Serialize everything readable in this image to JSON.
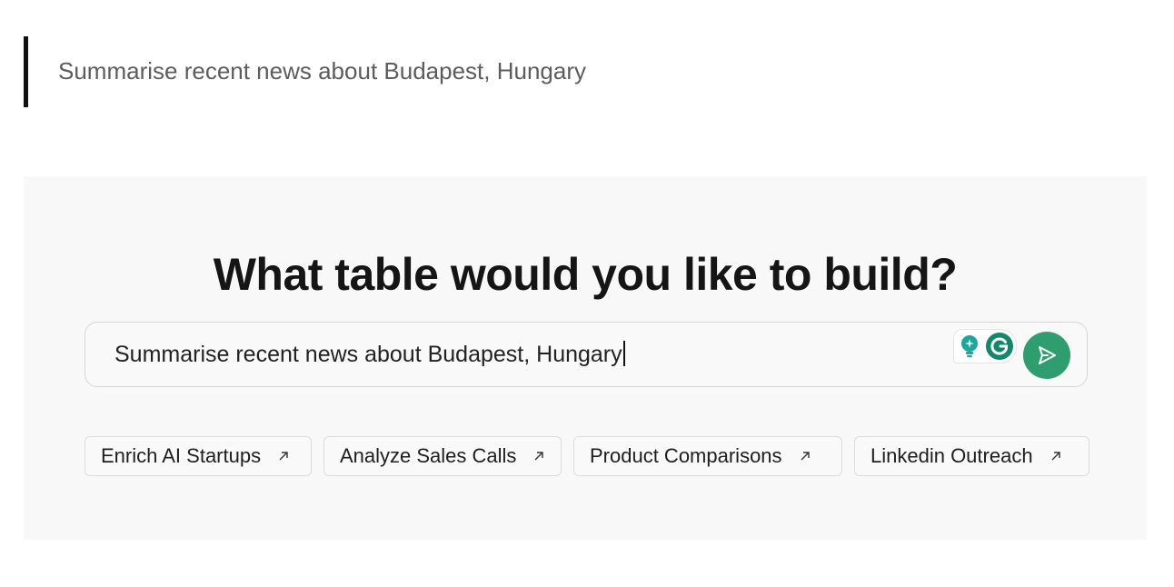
{
  "quote": {
    "text": "Summarise recent news about Budapest, Hungary"
  },
  "panel": {
    "heading": "What table would you like to build?",
    "prompt_value": "Summarise recent news about Budapest, Hungary",
    "send_icon": "send-icon",
    "extension_icons": [
      "lightbulb-icon",
      "grammarly-icon"
    ]
  },
  "suggestions": [
    {
      "label": "Enrich AI Startups",
      "icon": "arrow-up-right-icon"
    },
    {
      "label": "Analyze Sales Calls",
      "icon": "arrow-up-right-icon"
    },
    {
      "label": "Product Comparisons",
      "icon": "arrow-up-right-icon"
    },
    {
      "label": "Linkedin Outreach",
      "icon": "arrow-up-right-icon"
    }
  ],
  "colors": {
    "accent": "#2f9e6e",
    "panel_bg": "#f8f8f8",
    "quote_bar": "#111111"
  }
}
